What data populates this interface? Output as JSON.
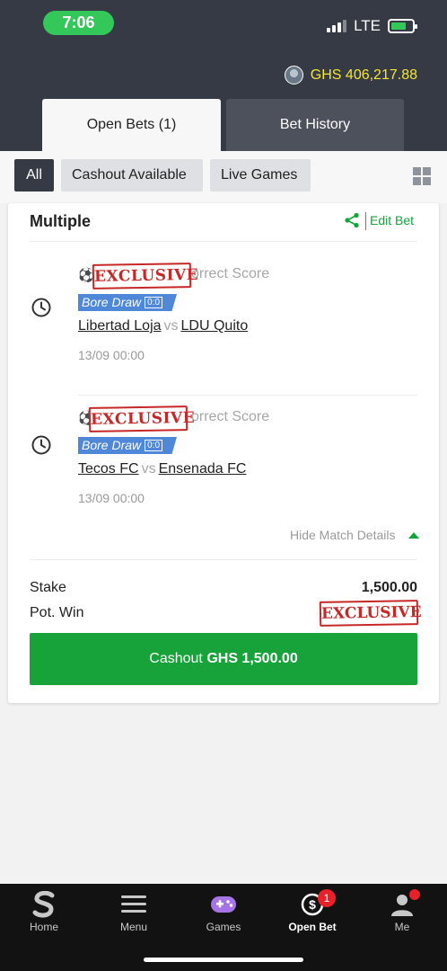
{
  "status_bar": {
    "time": "7:06",
    "network": "LTE"
  },
  "header": {
    "balance": "GHS 406,217.88",
    "tabs": [
      {
        "label": "Open Bets (1)",
        "active": true
      },
      {
        "label": "Bet History",
        "active": false
      }
    ]
  },
  "filters": {
    "items": [
      {
        "label": "All",
        "active": true
      },
      {
        "label": "Cashout Available",
        "active": false
      },
      {
        "label": "Live Games",
        "active": false
      }
    ]
  },
  "bet": {
    "type": "Multiple",
    "edit_label": "Edit Bet",
    "selections": [
      {
        "market": "Correct Score",
        "market_visible": "orrect Score",
        "stamp": "EXCLUSIVE",
        "pick": "Bore Draw",
        "pick_score": "0:0",
        "home": "Libertad Loja",
        "vs": "vs",
        "away": "LDU Quito",
        "date": "13/09 00:00"
      },
      {
        "market": "Correct Score",
        "market_visible": "orrect Score",
        "stamp": "EXCLUSIVE",
        "pick": "Bore Draw",
        "pick_score": "0:0",
        "home": "Tecos FC",
        "vs": "vs",
        "away": "Ensenada FC",
        "date": "13/09 00:00"
      }
    ],
    "hide_details_label": "Hide Match Details",
    "stake_label": "Stake",
    "stake_value": "1,500.00",
    "pot_win_label": "Pot. Win",
    "pot_win_stamp": "EXCLUSIVE",
    "cashout_prefix": "Cashout",
    "cashout_amount": "GHS 1,500.00"
  },
  "bottom_nav": {
    "items": [
      {
        "label": "Home",
        "icon": "sportybet-s-icon"
      },
      {
        "label": "Menu",
        "icon": "hamburger-icon"
      },
      {
        "label": "Games",
        "icon": "gamepad-icon"
      },
      {
        "label": "Open Bet",
        "icon": "open-bet-icon",
        "badge": "1",
        "active": true
      },
      {
        "label": "Me",
        "icon": "user-icon"
      }
    ]
  },
  "colors": {
    "header_bg": "#353a45",
    "accent_green": "#17a33a",
    "balance_yellow": "#f5e632",
    "stamp_red": "#c62828",
    "pick_blue": "#4f87d9"
  }
}
